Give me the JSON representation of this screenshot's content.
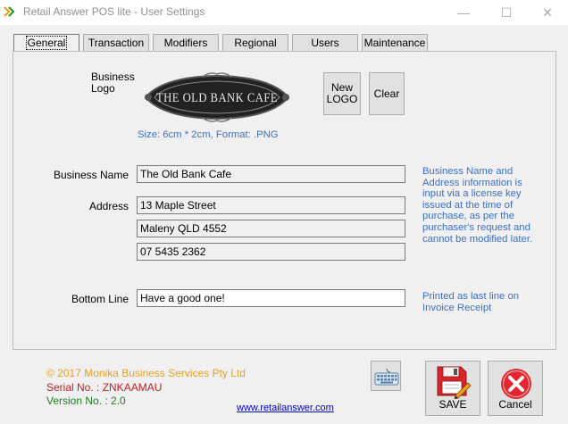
{
  "window": {
    "title": "Retail Answer POS lite - User Settings",
    "minimize_glyph": "—",
    "maximize_glyph": "☐",
    "close_glyph": "✕"
  },
  "tabs": [
    {
      "label": "General",
      "active": true
    },
    {
      "label": "Transaction",
      "active": false
    },
    {
      "label": "Modifiers",
      "active": false
    },
    {
      "label": "Regional",
      "active": false
    },
    {
      "label": "Users",
      "active": false
    },
    {
      "label": "Maintenance",
      "active": false
    }
  ],
  "general": {
    "logo_label": "Business\nLogo",
    "logo_text": "The Old Bank Cafe",
    "logo_hint": "Size: 6cm * 2cm, Format: .PNG",
    "new_logo_label": "New\nLOGO",
    "clear_label": "Clear",
    "business_name_label": "Business Name",
    "business_name": "The Old Bank Cafe",
    "address_label": "Address",
    "address_line1": "13 Maple Street",
    "address_line2": "Maleny QLD 4552",
    "address_line3": "07 5435 2362",
    "license_note": "Business Name and Address information is input via a license key issued at the time of purchase, as per the purchaser's request and cannot be modified later.",
    "bottom_line_label": "Bottom Line",
    "bottom_line_value": "Have a good one!",
    "bottom_line_note": "Printed as last line on Invoice Receipt"
  },
  "footer": {
    "copyright": "© 2017 Monika Business Services Pty Ltd",
    "serial": "Serial No. : ZNKAAMAU",
    "version": "Version No. : 2.0",
    "website": "www.retailanswer.com",
    "save_label": "SAVE",
    "cancel_label": "Cancel"
  },
  "colors": {
    "copyright": "#e8a020",
    "serial": "#c02020",
    "version": "#208020",
    "note": "#3b6fc9",
    "link": "#0000cc"
  },
  "icons": {
    "app": "double-chevron-icon",
    "keyboard": "keyboard-icon",
    "save": "floppy-pencil-icon",
    "cancel": "red-x-circle-icon"
  }
}
